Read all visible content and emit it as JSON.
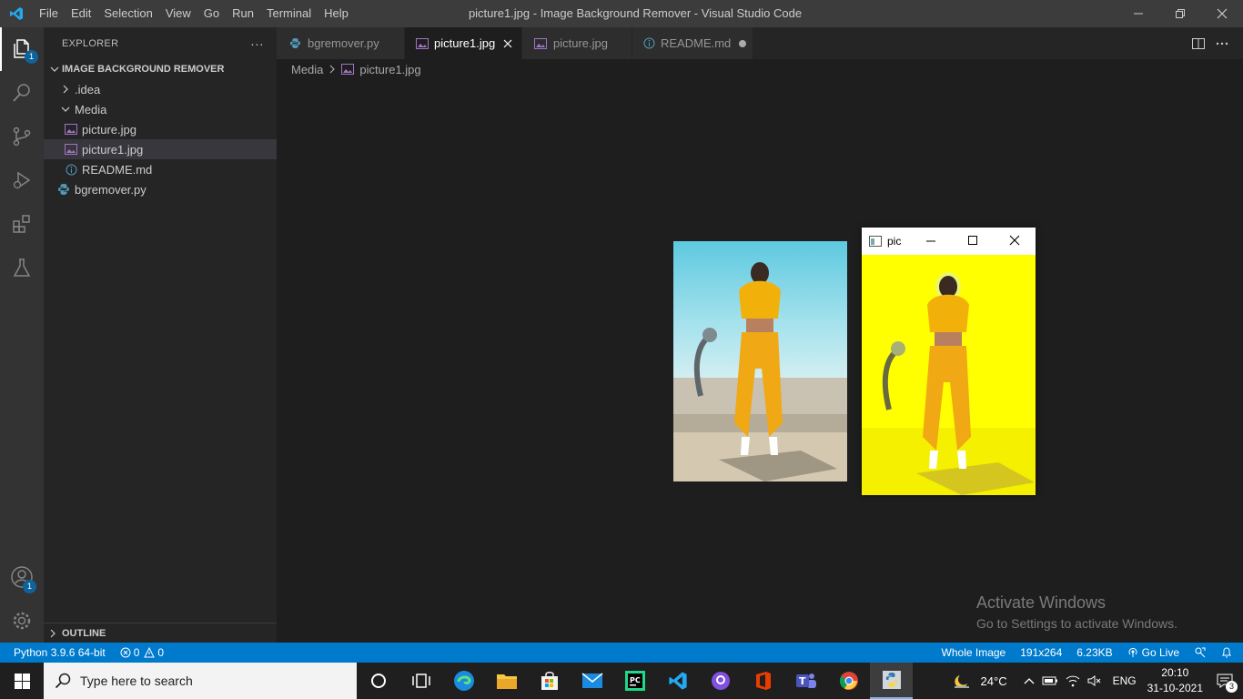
{
  "titlebar": {
    "menu": [
      "File",
      "Edit",
      "Selection",
      "View",
      "Go",
      "Run",
      "Terminal",
      "Help"
    ],
    "title": "picture1.jpg - Image Background Remover - Visual Studio Code"
  },
  "activitybar": {
    "explorer_badge": "1",
    "accounts_badge": "1"
  },
  "sidebar": {
    "title": "EXPLORER",
    "more": "···",
    "root": "IMAGE BACKGROUND REMOVER",
    "items": [
      {
        "label": ".idea",
        "type": "folder-collapsed"
      },
      {
        "label": "Media",
        "type": "folder-expanded"
      },
      {
        "label": "picture.jpg",
        "type": "image"
      },
      {
        "label": "picture1.jpg",
        "type": "image"
      },
      {
        "label": "README.md",
        "type": "info"
      },
      {
        "label": "bgremover.py",
        "type": "python"
      }
    ],
    "outline": "OUTLINE"
  },
  "tabs": [
    {
      "label": "bgremover.py",
      "type": "python"
    },
    {
      "label": "picture1.jpg",
      "type": "image"
    },
    {
      "label": "picture.jpg",
      "type": "image"
    },
    {
      "label": "README.md",
      "type": "info"
    }
  ],
  "breadcrumb": {
    "folder": "Media",
    "file": "picture1.jpg"
  },
  "pic_window": {
    "title": "pic"
  },
  "activate": {
    "line1": "Activate Windows",
    "line2": "Go to Settings to activate Windows."
  },
  "statusbar": {
    "python": "Python 3.9.6 64-bit",
    "errors": "0",
    "warnings": "0",
    "zoom": "Whole Image",
    "dimensions": "191x264",
    "size": "6.23KB",
    "golive": "Go Live"
  },
  "taskbar": {
    "search_placeholder": "Type here to search",
    "weather": "24°C",
    "language": "ENG",
    "time": "20:10",
    "date": "31-10-2021",
    "notifications": "3"
  },
  "colors": {
    "accent": "#007acc",
    "activity_bg": "#333333",
    "sidebar_bg": "#252526",
    "editor_bg": "#1e1e1e",
    "image_file_icon": "#a074c4",
    "python_icon": "#519aba",
    "highlight_yellow": "#ffff00"
  }
}
